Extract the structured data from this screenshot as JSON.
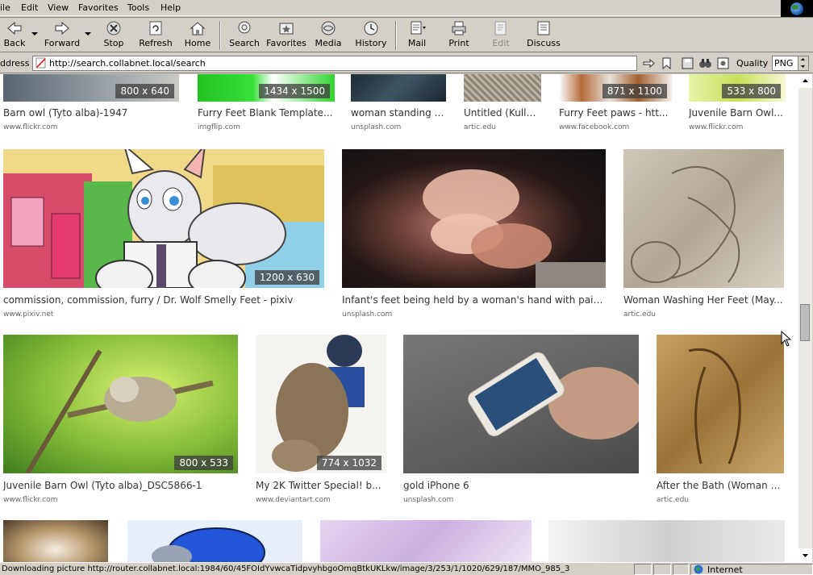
{
  "menu": [
    "ile",
    "Edit",
    "View",
    "Favorites",
    "Tools",
    "Help"
  ],
  "toolbar": {
    "back": "Back",
    "forward": "Forward",
    "stop": "Stop",
    "refresh": "Refresh",
    "home": "Home",
    "search": "Search",
    "favorites": "Favorites",
    "media": "Media",
    "history": "History",
    "mail": "Mail",
    "print": "Print",
    "edit": "Edit",
    "discuss": "Discuss"
  },
  "address": {
    "label": "ddress",
    "url": "http://search.collabnet.local/search",
    "quality_label": "Quality",
    "quality_value": "PNG"
  },
  "results_row1": [
    {
      "title": "Barn owl (Tyto alba)-1947",
      "source": "www.flickr.com",
      "size": "800 x 640"
    },
    {
      "title": "Furry Feet Blank Template...",
      "source": "imgflip.com",
      "size": "1434 x 1500"
    },
    {
      "title": "woman standing o...",
      "source": "unsplash.com",
      "size": ""
    },
    {
      "title": "Untitled (Kulle...",
      "source": "artic.edu",
      "size": ""
    },
    {
      "title": "Furry Feet paws - htt...",
      "source": "www.facebook.com",
      "size": "871 x 1100"
    },
    {
      "title": "Juvenile Barn Owl...",
      "source": "www.flickr.com",
      "size": "533 x 800"
    }
  ],
  "results_row2": [
    {
      "title": "commission, commission, furry / Dr. Wolf Smelly Feet - pixiv",
      "source": "www.pixiv.net",
      "size": "1200 x 630"
    },
    {
      "title": "Infant's feet being held by a woman's hand with painte...",
      "source": "unsplash.com",
      "size": ""
    },
    {
      "title": "Woman Washing Her Feet (May...",
      "source": "artic.edu",
      "size": ""
    }
  ],
  "results_row3": [
    {
      "title": "Juvenile Barn Owl (Tyto alba)_DSC5866-1",
      "source": "www.flickr.com",
      "size": "800 x 533"
    },
    {
      "title": "My 2K Twitter Special! b...",
      "source": "www.deviantart.com",
      "size": "774 x 1032"
    },
    {
      "title": "gold iPhone 6",
      "source": "unsplash.com",
      "size": ""
    },
    {
      "title": "After the Bath (Woman D...",
      "source": "artic.edu",
      "size": ""
    }
  ],
  "status": {
    "text": "Downloading picture http://router.collabnet.local:1984/60/45FOIdYvwcaTidpvyhbgoOmqBtkUKLkw/image/3/253/1/1020/629/187/MMO_985_3",
    "zone": "Internet"
  },
  "colors": {
    "chrome": "#d4d0c8",
    "page_bg": "#ffffff",
    "title_text": "#333333",
    "source_text": "#666666",
    "dim_badge": "#3c3c3c"
  }
}
